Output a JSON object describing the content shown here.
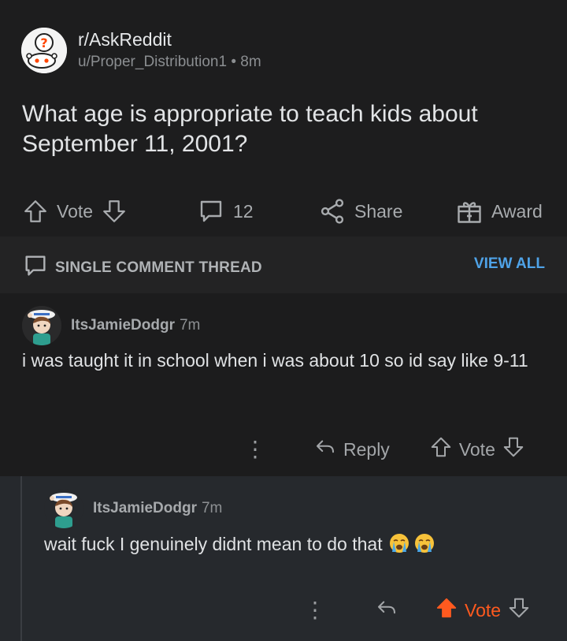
{
  "post": {
    "subreddit": "r/AskReddit",
    "author": "u/Proper_Distribution1",
    "separator": "•",
    "age": "8m",
    "title": "What age is appropriate to teach kids about September 11, 2001?",
    "actions": {
      "vote_label": "Vote",
      "comments_count": "12",
      "share_label": "Share",
      "award_label": "Award"
    }
  },
  "thread_bar": {
    "label": "SINGLE COMMENT THREAD",
    "view_all": "VIEW ALL"
  },
  "comments": [
    {
      "user": "ItsJamieDodgr",
      "time": "7m",
      "body": "i was taught it in school when i was about 10 so id say like 9-11",
      "more": "⋮",
      "reply_label": "Reply",
      "vote_label": "Vote"
    },
    {
      "user": "ItsJamieDodgr",
      "time": "7m",
      "body": "wait fuck I genuinely didnt mean to do that",
      "emojis": [
        "loudly-crying-face",
        "loudly-crying-face"
      ],
      "more": "⋮",
      "vote_label": "Vote",
      "upvoted": true
    }
  ],
  "colors": {
    "background": "#1a1a1b",
    "accent_blue": "#4fa3e8",
    "upvote_orange": "#ff5a1f"
  }
}
